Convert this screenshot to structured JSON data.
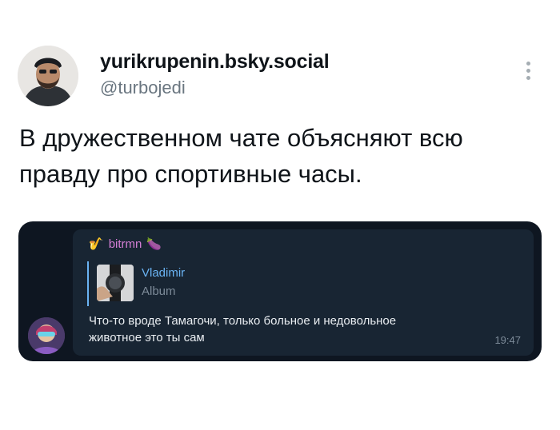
{
  "tweet": {
    "display_name": "yurikrupenin.bsky.social",
    "handle": "@turbojedi",
    "text_line1": "В дружественном чате объясняют всю",
    "text_line2": "правду про спортивные часы.",
    "more_icon": "vertical-ellipsis-icon"
  },
  "chat": {
    "sender_name": "bitrmn",
    "sender_prefix_emoji": "🎷",
    "sender_suffix_emoji": "🍆",
    "reply": {
      "author": "Vladimir",
      "subtitle": "Album"
    },
    "message_line1": "Что-то вроде Тамагочи, только больное и недовольное",
    "message_line2": "животное это ты сам",
    "time": "19:47",
    "colors": {
      "background": "#0e1621",
      "bubble": "#182533",
      "sender": "#d47fd6",
      "reply_accent": "#6ab3f3"
    }
  }
}
